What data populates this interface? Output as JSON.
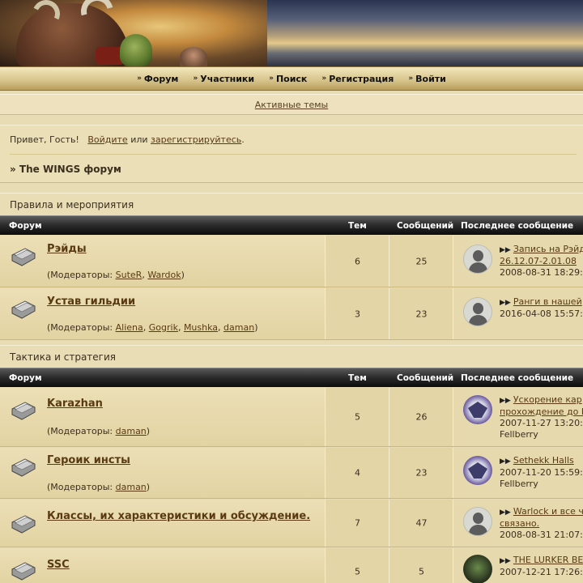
{
  "nav": {
    "items": [
      "Форум",
      "Участники",
      "Поиск",
      "Регистрация",
      "Войти"
    ],
    "active_topics": "Активные темы"
  },
  "welcome": {
    "prefix": "Привет, Гость!",
    "login": "Войдите",
    "or": "или",
    "register": "зарегистрируйтесь",
    "dot": ".",
    "breadcrumb": "» The WINGS форум"
  },
  "headers": {
    "forum": "Форум",
    "topics": "Тем",
    "posts": "Сообщений",
    "last": "Последнее сообщение"
  },
  "mods_label": "(Модераторы: ",
  "categories": [
    {
      "title": "Правила и мероприятия",
      "forums": [
        {
          "name": "Рэйды",
          "mods": [
            "SuteR",
            "Wardok"
          ],
          "topics": "6",
          "posts": "25",
          "last_title_1": "Запись на Рэйд",
          "last_title_2": "26.12.07-2.01.08",
          "last_date": "2008-08-31 18:29:",
          "last_user": "",
          "avatar": "default"
        },
        {
          "name": "Устав гильдии",
          "mods": [
            "Aliena",
            "Gogrik",
            "Mushka",
            "daman"
          ],
          "topics": "3",
          "posts": "23",
          "last_title_1": "Ранги в нашей",
          "last_title_2": "",
          "last_date": "2016-04-08 15:57:",
          "last_user": "",
          "avatar": "default"
        }
      ]
    },
    {
      "title": "Тактика и стратегия",
      "forums": [
        {
          "name": "Karazhan",
          "mods": [
            "daman"
          ],
          "topics": "5",
          "posts": "26",
          "last_title_1": "Ускорение кар",
          "last_title_2": "прохождение до I",
          "last_date": "2007-11-27 13:20:",
          "last_user": "Fellberry",
          "avatar": "dragon"
        },
        {
          "name": "Героик инсты",
          "mods": [
            "daman"
          ],
          "topics": "4",
          "posts": "23",
          "last_title_1": "Sethekk Halls",
          "last_title_2": "",
          "last_date": "2007-11-20 15:59:",
          "last_user": "Fellberry",
          "avatar": "dragon"
        },
        {
          "name": "Классы, их характеристики и обсуждение.",
          "mods": [],
          "topics": "7",
          "posts": "47",
          "last_title_1": "Warlock и все ч",
          "last_title_2": "связано.",
          "last_date": "2008-08-31 21:07:",
          "last_user": "",
          "avatar": "default"
        },
        {
          "name": "SSC",
          "mods": [],
          "topics": "5",
          "posts": "5",
          "last_title_1": "THE LURKER BE",
          "last_title_2": "",
          "last_date": "2007-12-21 17:26:",
          "last_user": "",
          "avatar": "dark"
        }
      ]
    }
  ]
}
